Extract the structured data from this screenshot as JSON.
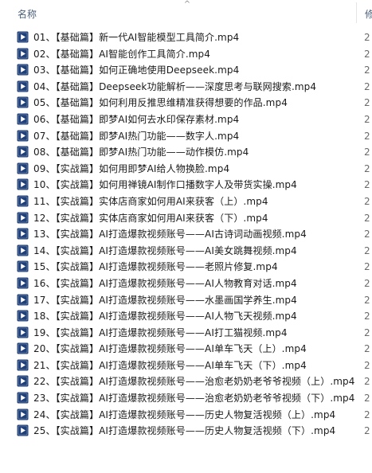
{
  "header": {
    "name_column": "名称",
    "next_column": "修",
    "sort_indicator": "^"
  },
  "files": [
    {
      "name": "01、【基础篇】新一代AI智能模型工具简介.mp4",
      "extra": "2"
    },
    {
      "name": "02、【基础篇】AI智能创作工具简介.mp4",
      "extra": "2"
    },
    {
      "name": "03、【基础篇】如何正确地使用Deepseek.mp4",
      "extra": "2"
    },
    {
      "name": "04、【基础篇】Deepseek功能解析——深度思考与联网搜索.mp4",
      "extra": "2"
    },
    {
      "name": "05、【基础篇】如何利用反推思维精准获得想要的作品.mp4",
      "extra": "2"
    },
    {
      "name": "06、【基础篇】即梦AI如何去水印保存素材.mp4",
      "extra": "2"
    },
    {
      "name": "07、【基础篇】即梦AI热门功能——数字人.mp4",
      "extra": "2"
    },
    {
      "name": "08、【基础篇】即梦AI热门功能——动作模仿.mp4",
      "extra": "2"
    },
    {
      "name": "09、【实战篇】如何用即梦AI给人物换脸.mp4",
      "extra": "2"
    },
    {
      "name": "10、【实战篇】如何用禅镜AI制作口播数字人及带货实操.mp4",
      "extra": "2"
    },
    {
      "name": "11、【实战篇】实体店商家如何用AI来获客（上）.mp4",
      "extra": "2"
    },
    {
      "name": "12、【实战篇】实体店商家如何用AI来获客（下）.mp4",
      "extra": "2"
    },
    {
      "name": "13、【实战篇】AI打造爆款视频账号——AI古诗词动画视频.mp4",
      "extra": "2"
    },
    {
      "name": "14、【实战篇】AI打造爆款视频账号——AI美女跳舞视频.mp4",
      "extra": "2"
    },
    {
      "name": "15、【实战篇】AI打造爆款视频账号——老照片修复.mp4",
      "extra": "2"
    },
    {
      "name": "16、【实战篇】AI打造爆款视频账号——AI人物教育对话.mp4",
      "extra": "2"
    },
    {
      "name": "17、【实战篇】AI打造爆款视频账号——水墨画国学养生.mp4",
      "extra": "2"
    },
    {
      "name": "18、【实战篇】AI打造爆款视频账号——AI人物飞天视频.mp4",
      "extra": "2"
    },
    {
      "name": "19、【实战篇】AI打造爆款视频账号——AI打工猫视频.mp4",
      "extra": "2"
    },
    {
      "name": "20、【实战篇】AI打造爆款视频账号——AI单车飞天（上）.mp4",
      "extra": "2"
    },
    {
      "name": "21、【实战篇】AI打造爆款视频账号——AI单车飞天（下）.mp4",
      "extra": "2"
    },
    {
      "name": "22、【实战篇】AI打造爆款视频账号——治愈老奶奶老爷爷视频（上）.mp4",
      "extra": "2"
    },
    {
      "name": "23、【实战篇】AI打造爆款视频账号——治愈老奶奶老爷爷视频（下）.mp4",
      "extra": "2"
    },
    {
      "name": "24、【实战篇】AI打造爆款视频账号——历史人物复活视频（上）.mp4",
      "extra": "2"
    },
    {
      "name": "25、【实战篇】AI打造爆款视频账号——历史人物复活视频（下）.mp4",
      "extra": "2"
    }
  ],
  "icon": {
    "name": "video-file-icon",
    "color": "#1f3f78",
    "accent": "#ffffff"
  }
}
